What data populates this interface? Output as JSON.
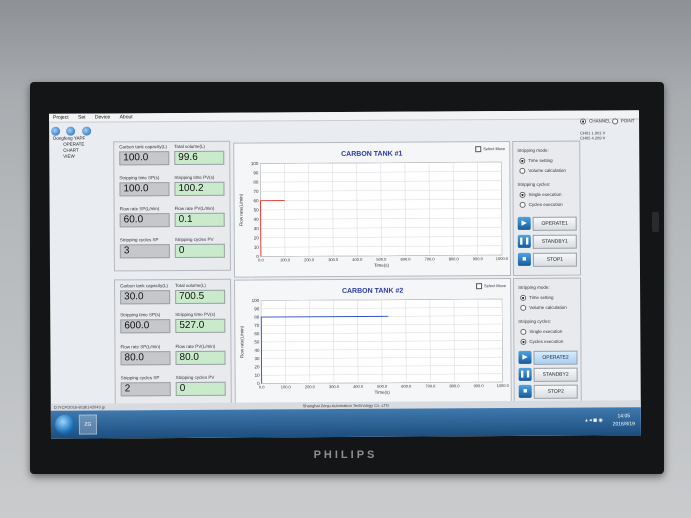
{
  "menu": [
    "Project",
    "Set",
    "Device",
    "About"
  ],
  "tree": {
    "root": "Dongfeng YAPF",
    "children": [
      "OPERATE",
      "CHART",
      "VIEW"
    ]
  },
  "tank1": {
    "capacity_label": "Carbon tank capacity(L)",
    "capacity": "100.0",
    "total_label": "Total volume(L)",
    "total": "99.6",
    "sp_time_label": "Stripping time SP(s)",
    "sp_time": "100.0",
    "pv_time_label": "Stripping time PV(s)",
    "pv_time": "100.2",
    "flow_sp_label": "Flow rate SP(L/min)",
    "flow_sp": "60.0",
    "flow_pv_label": "Flow rate PV(L/min)",
    "flow_pv": "0.1",
    "cycles_sp_label": "Stripping cycles SP",
    "cycles_sp": "3",
    "cycles_pv_label": "Stripping cycles PV",
    "cycles_pv": "0"
  },
  "tank2": {
    "capacity_label": "Carbon tank capacity(L)",
    "capacity": "30.0",
    "total_label": "Total volume(L)",
    "total": "700.5",
    "sp_time_label": "Stripping time SP(s)",
    "sp_time": "600.0",
    "pv_time_label": "Stripping time PV(s)",
    "pv_time": "527.0",
    "flow_sp_label": "Flow rate SP(L/min)",
    "flow_sp": "80.0",
    "flow_pv_label": "Flow rate PV(L/min)",
    "flow_pv": "80.0",
    "cycles_sp_label": "Stripping cycles SP",
    "cycles_sp": "2",
    "cycles_pv_label": "Stripping cycles PV",
    "cycles_pv": "0"
  },
  "chart1": {
    "title": "CARBON TANK #1",
    "select_label": "Select Move",
    "ylabel": "Flow rate(L/min)",
    "xlabel": "Time(s)"
  },
  "chart2": {
    "title": "CARBON TANK #2",
    "select_label": "Select Move",
    "ylabel": "Flow rate(L/min)",
    "xlabel": "Time(s)"
  },
  "chart_data": [
    {
      "type": "line",
      "title": "CARBON TANK #1",
      "xlabel": "Time(s)",
      "ylabel": "Flow rate(L/min)",
      "xlim": [
        0,
        1000
      ],
      "ylim": [
        0,
        100
      ],
      "grid": true,
      "color": "#e0302b",
      "x": [
        0,
        0,
        100
      ],
      "y": [
        0,
        60,
        60
      ],
      "xticks": [
        "0.0",
        "100.0",
        "200.0",
        "300.0",
        "400.0",
        "500.0",
        "600.0",
        "700.0",
        "800.0",
        "900.0",
        "1000.0"
      ],
      "yticks": [
        "0",
        "10",
        "20",
        "30",
        "40",
        "50",
        "60",
        "70",
        "80",
        "90",
        "100"
      ]
    },
    {
      "type": "line",
      "title": "CARBON TANK #2",
      "xlabel": "Time(s)",
      "ylabel": "Flow rate(L/min)",
      "xlim": [
        0,
        1000
      ],
      "ylim": [
        0,
        100
      ],
      "grid": true,
      "color": "#3050c8",
      "x": [
        0,
        0,
        527
      ],
      "y": [
        0,
        80,
        80
      ],
      "xticks": [
        "0.0",
        "100.0",
        "200.0",
        "300.0",
        "400.0",
        "500.0",
        "600.0",
        "700.0",
        "800.0",
        "900.0",
        "1000.0"
      ],
      "yticks": [
        "0",
        "10",
        "20",
        "30",
        "40",
        "50",
        "60",
        "70",
        "80",
        "90",
        "100"
      ]
    }
  ],
  "ctrl1": {
    "mode_label": "Stripping mode:",
    "mode_a": "Time setting",
    "mode_b": "Volume calculation",
    "cycle_label": "Stripping cycles:",
    "cycle_a": "Single execution",
    "cycle_b": "Cycles execution",
    "operate": "OPERATE1",
    "standby": "STANDBY1",
    "stop": "STOP1"
  },
  "ctrl2": {
    "mode_label": "Stripping mode:",
    "mode_a": "Time setting",
    "mode_b": "Volume calculation",
    "cycle_label": "Stripping cycles:",
    "cycle_a": "Single execution",
    "cycle_b": "Cycles execution",
    "operate": "OPERATE2",
    "standby": "STANDBY2",
    "stop": "STOP2"
  },
  "right": {
    "channel": "CHANNEL",
    "point": "POINT",
    "ch1": "CH01",
    "ch1_val": "1.001 V",
    "ch2": "CH02",
    "ch2_val": "4.209 V"
  },
  "status": {
    "path": "D:\\YCP\\2016-8\\18\\142049.jp",
    "company": "Shanghai Zenju Automation Technology Co.,LTD"
  },
  "taskbar": {
    "time": "14:05",
    "date": "2016/8/19",
    "app": "ZG"
  },
  "monitor_brand": "PHILIPS"
}
